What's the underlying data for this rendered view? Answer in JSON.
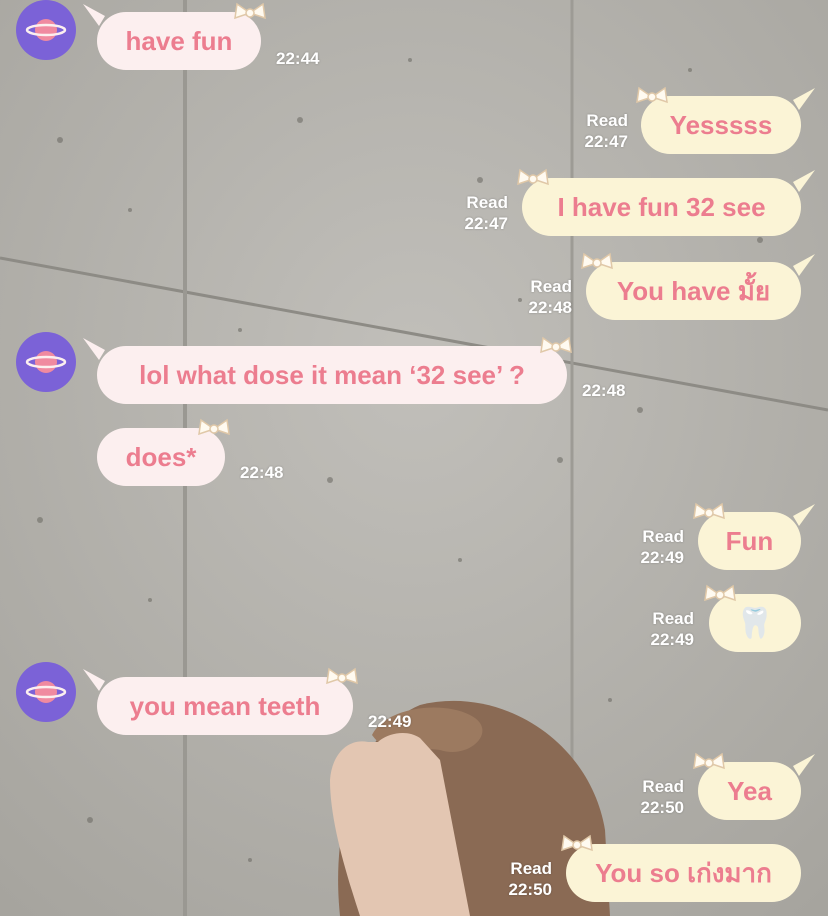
{
  "colors": {
    "incoming_bubble": "#fcefef",
    "outgoing_bubble": "#fbf4d6",
    "bubble_text": "#ec7d8f",
    "avatar_bg": "#7b62d7",
    "planet": "#f08aa0"
  },
  "icons": {
    "avatar": "planet-icon",
    "bubble_decoration": "bow-icon"
  },
  "messages": [
    {
      "side": "in",
      "text": "have fun",
      "time": "22:44",
      "read": ""
    },
    {
      "side": "out",
      "text": "Yesssss",
      "time": "22:47",
      "read": "Read"
    },
    {
      "side": "out",
      "text": "I have fun 32 see",
      "time": "22:47",
      "read": "Read"
    },
    {
      "side": "out",
      "text": "You have มั้ย",
      "time": "22:48",
      "read": "Read"
    },
    {
      "side": "in",
      "text": "lol what dose it mean ‘32 see’ ?",
      "time": "22:48",
      "read": ""
    },
    {
      "side": "in",
      "text": "does*",
      "time": "22:48",
      "read": ""
    },
    {
      "side": "out",
      "text": "Fun",
      "time": "22:49",
      "read": "Read"
    },
    {
      "side": "out",
      "text": "🦷",
      "time": "22:49",
      "read": "Read"
    },
    {
      "side": "in",
      "text": "you mean teeth",
      "time": "22:49",
      "read": ""
    },
    {
      "side": "out",
      "text": "Yea",
      "time": "22:50",
      "read": "Read"
    },
    {
      "side": "out",
      "text": "You so เก่งมาก",
      "time": "22:50",
      "read": "Read"
    }
  ]
}
